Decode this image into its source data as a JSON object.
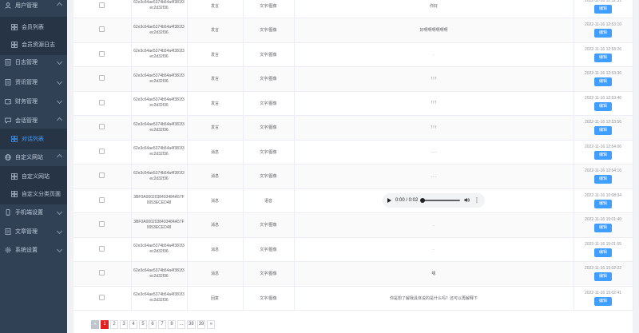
{
  "sidebar": {
    "items": [
      {
        "label": "用户管理",
        "icon": "user-icon",
        "level": 0,
        "expanded": true
      },
      {
        "label": "会员列表",
        "icon": "grid-icon",
        "level": 1
      },
      {
        "label": "会员资源日志",
        "icon": "grid-icon",
        "level": 1
      },
      {
        "label": "日志管理",
        "icon": "document-icon",
        "level": 0
      },
      {
        "label": "资讯管理",
        "icon": "document-icon",
        "level": 0
      },
      {
        "label": "财务管理",
        "icon": "wallet-icon",
        "level": 0
      },
      {
        "label": "会话管理",
        "icon": "chat-icon",
        "level": 0,
        "expanded": true
      },
      {
        "label": "对话列表",
        "icon": "grid-icon",
        "level": 1,
        "active": true
      },
      {
        "label": "自定义网站",
        "icon": "globe-icon",
        "level": 0,
        "expanded": true
      },
      {
        "label": "自定义网站",
        "icon": "grid-icon",
        "level": 1
      },
      {
        "label": "自定义分类页面",
        "icon": "grid-icon",
        "level": 1
      },
      {
        "label": "手机端设置",
        "icon": "phone-icon",
        "level": 0
      },
      {
        "label": "文章管理",
        "icon": "document-icon",
        "level": 0
      },
      {
        "label": "系统设置",
        "icon": "gear-icon",
        "level": 0
      }
    ]
  },
  "table": {
    "action_label": "编辑",
    "rows": [
      {
        "uid": "62e3c64ae5374b54a4f381f3ec2d32f36",
        "role": "发言",
        "type": "文字/图像",
        "content": "你好",
        "time": "2022-11-16 12:52:31"
      },
      {
        "uid": "62e3c64ae5374b54a4f381f3ec2d32f36",
        "role": "发言",
        "type": "文字/图像",
        "content": "好啊啊啊啊啊啊",
        "time": "2022-11-16 12:53:10"
      },
      {
        "uid": "62e3c64ae5374b54a4f381f3ec2d32f36",
        "role": "发言",
        "type": "文字/图像",
        "content": ".",
        "time": "2022-11-16 12:53:26"
      },
      {
        "uid": "62e3c64ae5374b54a4f381f3ec2d32f36",
        "role": "发言",
        "type": "文字/图像",
        "content": "! ! !",
        "time": "2022-11-16 12:53:36"
      },
      {
        "uid": "62e3c64ae5374b54a4f381f3ec2d32f36",
        "role": "发言",
        "type": "文字/图像",
        "content": "! ! !",
        "time": "2022-11-16 12:53:46"
      },
      {
        "uid": "62e3c64ae5374b54a4f381f3ec2d32f36",
        "role": "发言",
        "type": "文字/图像",
        "content": "! ! !",
        "time": "2022-11-16 12:53:56"
      },
      {
        "uid": "62e3c64ae5374b54a4f381f3ec2d32f36",
        "role": "消息",
        "type": "文字/图像",
        "content": ". . .",
        "time": "2022-11-16 12:54:06"
      },
      {
        "uid": "62e3c64ae5374b54a4f381f3ec2d32f36",
        "role": "消息",
        "type": "文字/图像",
        "content": ". . .",
        "time": "2022-11-16 12:54:16"
      },
      {
        "uid": "3BF0A0002038493484A57F0053ECED48",
        "role": "消息",
        "type": "语音",
        "content": "",
        "audio": true,
        "time": "2022-11-16 10:08:34"
      },
      {
        "uid": "3BF0A0002038493484A57F0053ECED48",
        "role": "消息",
        "type": "文字/图像",
        "content": ".",
        "time": "2022-11-16 15:01:40"
      },
      {
        "uid": "62e3c64ae5374b54a4f381f3ec2d32f36",
        "role": "消息",
        "type": "文字/图像",
        "content": ".",
        "time": "2022-11-16 15:01:55"
      },
      {
        "uid": "62e3c64ae5374b54a4f381f3ec2d32f36",
        "role": "消息",
        "type": "文字/图像",
        "content": "嗯",
        "time": "2022-11-16 15:02:22"
      },
      {
        "uid": "62e3c64ae5374b54a4f381f3ec2d32f36",
        "role": "回复",
        "type": "文字/图像",
        "content": "你是想了解我具体说的是什么吗？还可以再解释下",
        "time": "2022-11-16 15:02:41"
      }
    ]
  },
  "audio": {
    "time": "0:00 / 0:02"
  },
  "pagination": {
    "prev": "«",
    "pages": [
      "1",
      "2",
      "3",
      "4",
      "5",
      "6",
      "7",
      "8",
      "...",
      "38",
      "39"
    ],
    "current": "1",
    "next": "»"
  }
}
